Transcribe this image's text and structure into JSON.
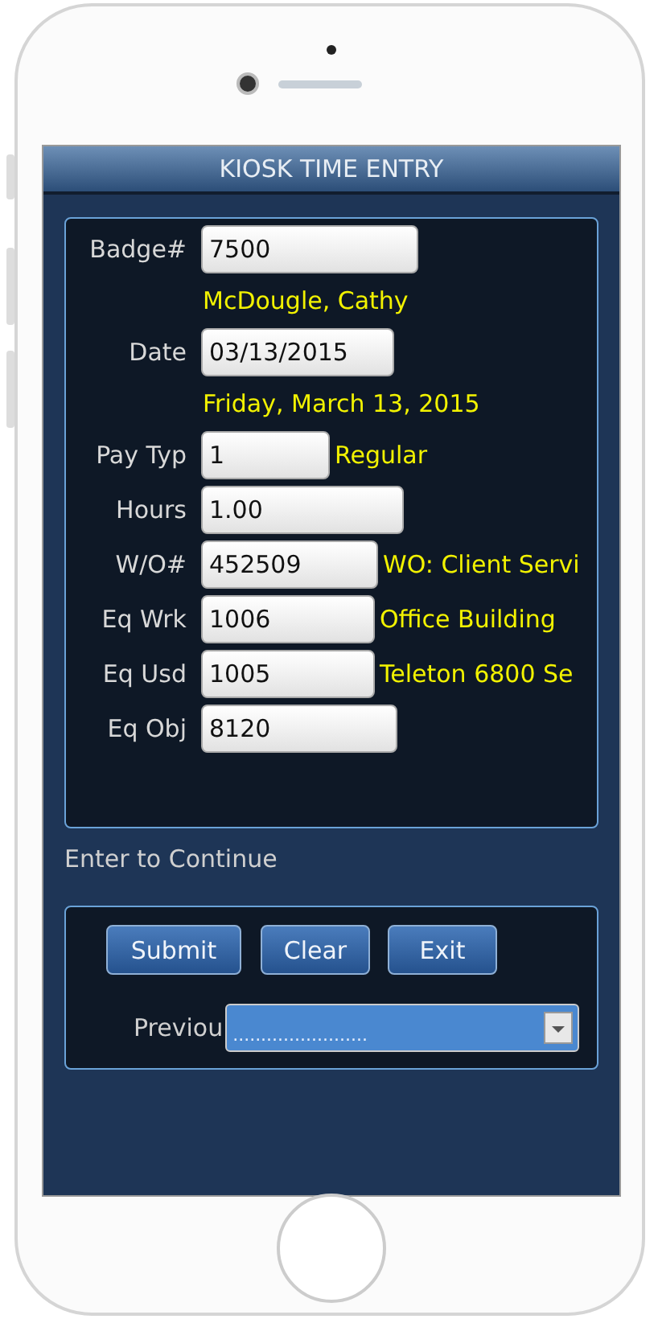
{
  "window": {
    "title": "KIOSK TIME ENTRY"
  },
  "fields": [
    {
      "label": "Badge#",
      "value": "7500",
      "note": "McDougle, Cathy",
      "kind": "stacked"
    },
    {
      "label": "Date",
      "value": "03/13/2015",
      "note": "Friday, March 13, 2015",
      "kind": "stacked"
    },
    {
      "label": "Pay Typ",
      "value": "1",
      "note": "Regular",
      "kind": "inline"
    },
    {
      "label": "Hours",
      "value": "1.00"
    },
    {
      "label": "W/O#",
      "value": "452509",
      "note": "WO: Client Servi",
      "kind": "inline"
    },
    {
      "label": "Eq Wrk",
      "value": "1006",
      "note": "Office Building",
      "kind": "inline"
    },
    {
      "label": "Eq Usd",
      "value": "1005",
      "note": "Teleton 6800 Se",
      "kind": "inline"
    },
    {
      "label": "Eq Obj",
      "value": "8120"
    }
  ],
  "hint": "Enter to Continue",
  "buttons": [
    "Submit",
    "Clear",
    "Exit"
  ],
  "previous": {
    "label": "Previou",
    "value": "........................"
  }
}
